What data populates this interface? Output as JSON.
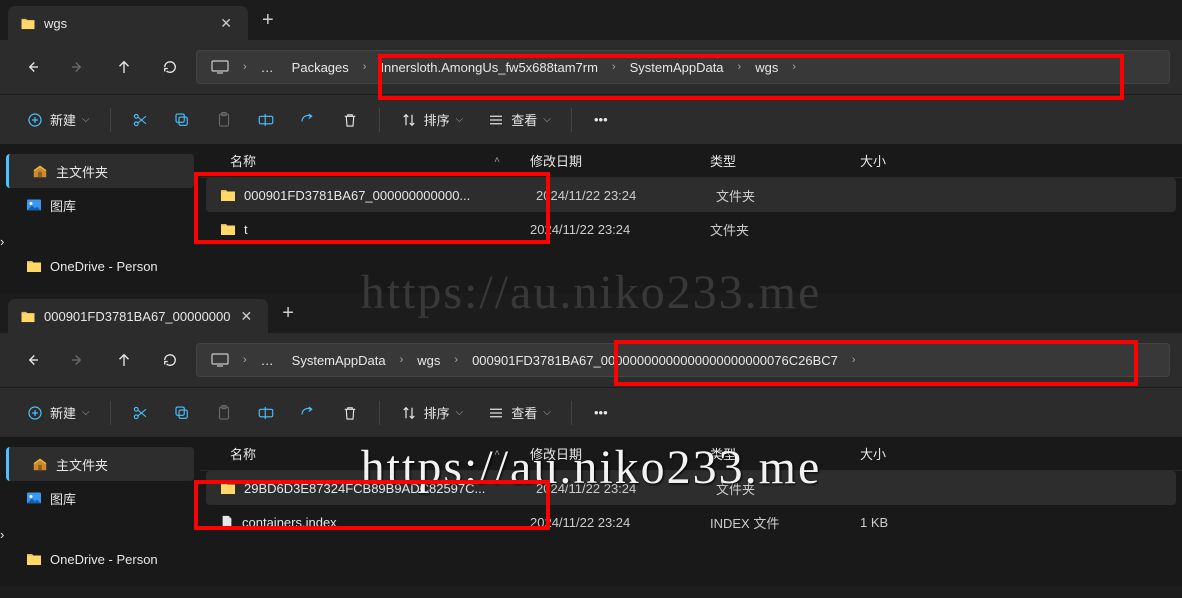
{
  "watermark": "https://au.niko233.me",
  "win1": {
    "tab_title": "wgs",
    "breadcrumbs": [
      "Packages",
      "Innersloth.AmongUs_fw5x688tam7rm",
      "SystemAppData",
      "wgs"
    ],
    "toolbar": {
      "new": "新建",
      "sort": "排序",
      "view": "查看"
    },
    "columns": {
      "name": "名称",
      "date": "修改日期",
      "type": "类型",
      "size": "大小"
    },
    "sidebar": {
      "home": "主文件夹",
      "gallery": "图库",
      "onedrive": "OneDrive - Person"
    },
    "rows": [
      {
        "name": "000901FD3781BA67_000000000000...",
        "date": "2024/11/22 23:24",
        "type": "文件夹",
        "size": "",
        "icon": "folder",
        "selected": true
      },
      {
        "name": "t",
        "date": "2024/11/22 23:24",
        "type": "文件夹",
        "size": "",
        "icon": "folder",
        "selected": false
      }
    ]
  },
  "win2": {
    "tab_title": "000901FD3781BA67_00000000",
    "breadcrumbs": [
      "SystemAppData",
      "wgs",
      "000901FD3781BA67_00000000000000000000000076C26BC7"
    ],
    "toolbar": {
      "new": "新建",
      "sort": "排序",
      "view": "查看"
    },
    "columns": {
      "name": "名称",
      "date": "修改日期",
      "type": "类型",
      "size": "大小"
    },
    "sidebar": {
      "home": "主文件夹",
      "gallery": "图库",
      "onedrive": "OneDrive - Person"
    },
    "rows": [
      {
        "name": "29BD6D3E87324FCB89B9ADC82597C...",
        "date": "2024/11/22 23:24",
        "type": "文件夹",
        "size": "",
        "icon": "folder",
        "selected": true
      },
      {
        "name": "containers.index",
        "date": "2024/11/22 23:24",
        "type": "INDEX 文件",
        "size": "1 KB",
        "icon": "file",
        "selected": false
      }
    ]
  }
}
